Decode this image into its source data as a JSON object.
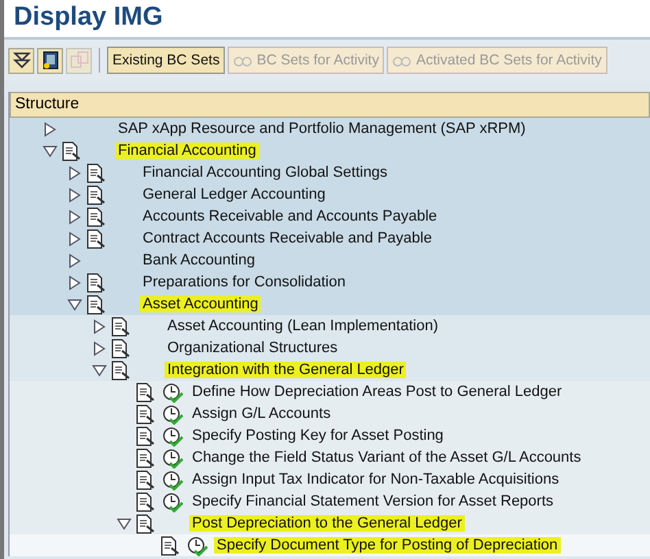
{
  "window": {
    "title": "Display IMG"
  },
  "toolbar": {
    "icon_buttons": [
      {
        "kind": "expand",
        "disabled": false
      },
      {
        "kind": "doc",
        "disabled": false
      },
      {
        "kind": "copy",
        "disabled": true
      }
    ],
    "buttons": [
      {
        "label": "Existing BC Sets",
        "disabled": false,
        "has_icon": false
      },
      {
        "label": "BC Sets for Activity",
        "disabled": true,
        "has_icon": true
      },
      {
        "label": "Activated BC Sets for Activity",
        "disabled": true,
        "has_icon": true
      }
    ]
  },
  "tree": {
    "header": "Structure",
    "nodes": [
      {
        "label": "SAP xApp Resource and Portfolio Management (SAP xRPM)",
        "kind": "folder",
        "expanded": false,
        "documentation": false,
        "highlighted": false
      },
      {
        "label": "Financial Accounting",
        "kind": "folder",
        "expanded": true,
        "documentation": true,
        "highlighted": true,
        "children": [
          {
            "label": "Financial Accounting Global Settings",
            "kind": "folder",
            "expanded": false,
            "documentation": true,
            "highlighted": false
          },
          {
            "label": "General Ledger Accounting",
            "kind": "folder",
            "expanded": false,
            "documentation": true,
            "highlighted": false
          },
          {
            "label": "Accounts Receivable and Accounts Payable",
            "kind": "folder",
            "expanded": false,
            "documentation": true,
            "highlighted": false
          },
          {
            "label": "Contract Accounts Receivable and Payable",
            "kind": "folder",
            "expanded": false,
            "documentation": true,
            "highlighted": false
          },
          {
            "label": "Bank Accounting",
            "kind": "folder",
            "expanded": false,
            "documentation": false,
            "highlighted": false
          },
          {
            "label": "Preparations for Consolidation",
            "kind": "folder",
            "expanded": false,
            "documentation": true,
            "highlighted": false
          },
          {
            "label": "Asset Accounting",
            "kind": "folder",
            "expanded": true,
            "documentation": true,
            "highlighted": true,
            "children": [
              {
                "label": "Asset Accounting (Lean Implementation)",
                "kind": "folder",
                "expanded": false,
                "documentation": true,
                "highlighted": false
              },
              {
                "label": "Organizational Structures",
                "kind": "folder",
                "expanded": false,
                "documentation": true,
                "highlighted": false
              },
              {
                "label": "Integration with the General Ledger",
                "kind": "folder",
                "expanded": true,
                "documentation": true,
                "highlighted": true,
                "children": [
                  {
                    "label": "Define How Depreciation Areas Post to General Ledger",
                    "kind": "activity",
                    "documentation": true,
                    "highlighted": false
                  },
                  {
                    "label": "Assign G/L Accounts",
                    "kind": "activity",
                    "documentation": true,
                    "highlighted": false
                  },
                  {
                    "label": "Specify Posting Key for Asset Posting",
                    "kind": "activity",
                    "documentation": true,
                    "highlighted": false
                  },
                  {
                    "label": "Change the Field Status Variant of the Asset G/L Accounts",
                    "kind": "activity",
                    "documentation": true,
                    "highlighted": false
                  },
                  {
                    "label": "Assign Input Tax Indicator for Non-Taxable Acquisitions",
                    "kind": "activity",
                    "documentation": true,
                    "highlighted": false
                  },
                  {
                    "label": "Specify Financial Statement Version for Asset Reports",
                    "kind": "activity",
                    "documentation": true,
                    "highlighted": false
                  },
                  {
                    "label": "Post Depreciation to the General Ledger",
                    "kind": "folder",
                    "expanded": true,
                    "documentation": true,
                    "highlighted": true,
                    "children": [
                      {
                        "label": "Specify Document Type for Posting of Depreciation",
                        "kind": "activity",
                        "documentation": true,
                        "highlighted": true
                      }
                    ]
                  }
                ]
              }
            ]
          }
        ]
      }
    ]
  }
}
